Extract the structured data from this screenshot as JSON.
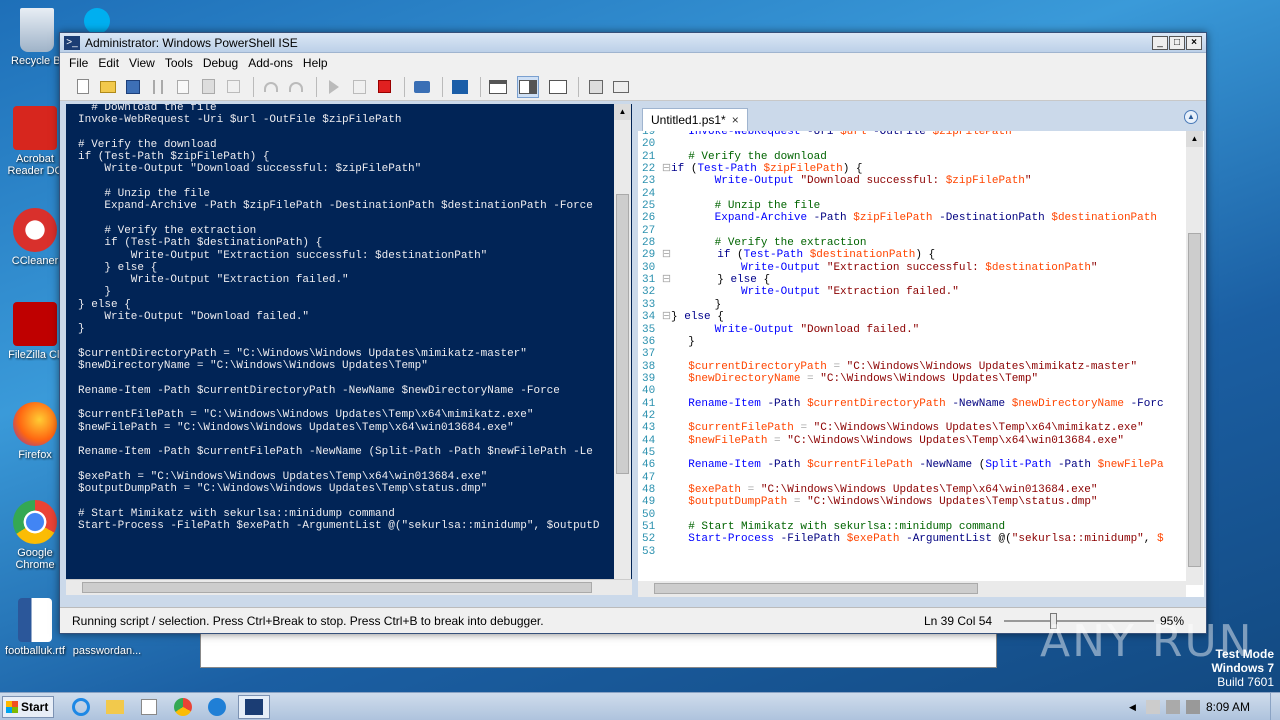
{
  "desktop": {
    "icons": [
      {
        "label": "Recycle Bi",
        "icon": "recycle-bin-icon"
      },
      {
        "label": "Acrobat Reader DC",
        "icon": "acrobat-icon"
      },
      {
        "label": "CCleaner",
        "icon": "ccleaner-icon"
      },
      {
        "label": "FileZilla Cli",
        "icon": "filezilla-icon"
      },
      {
        "label": "Firefox",
        "icon": "firefox-icon"
      },
      {
        "label": "Google Chrome",
        "icon": "chrome-icon"
      },
      {
        "label": "footballuk.rtf",
        "icon": "word-doc-icon"
      },
      {
        "label": "passwordan...",
        "icon": "file-icon"
      }
    ],
    "watermark": "ANY RUN",
    "test_mode": {
      "line1": "Test Mode",
      "line2": "Windows 7",
      "line3": "Build 7601"
    }
  },
  "window": {
    "title": "Administrator: Windows PowerShell ISE",
    "menu": [
      "File",
      "Edit",
      "View",
      "Tools",
      "Debug",
      "Add-ons",
      "Help"
    ],
    "controls": {
      "minimize": "_",
      "maximize": "□",
      "close": "×"
    }
  },
  "editor": {
    "tab_label": "Untitled1.ps1*",
    "tab_close": "×"
  },
  "status": {
    "message": "Running script / selection.  Press Ctrl+Break to stop.  Press Ctrl+B to break into debugger.",
    "position": "Ln 39  Col 54",
    "zoom": "95%",
    "zoom_level_pct": 95
  },
  "taskbar": {
    "start_label": "Start",
    "apps": [
      "ie-icon",
      "explorer-icon",
      "media-player-icon",
      "chrome-icon",
      "edge-icon",
      "powershell-icon"
    ],
    "clock": "8:09 AM"
  }
}
